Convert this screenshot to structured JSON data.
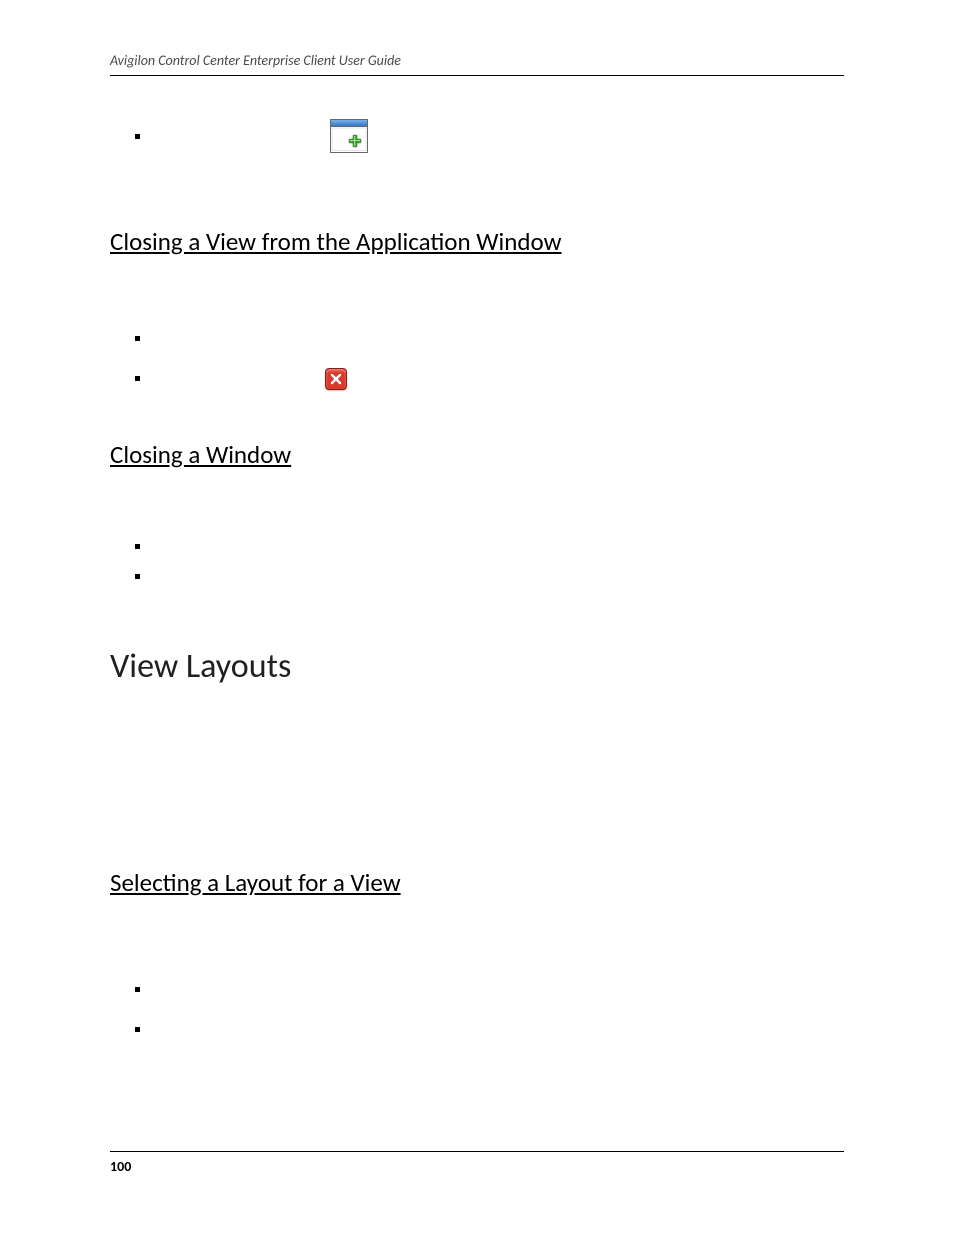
{
  "header": {
    "running_title": "Avigilon Control Center Enterprise Client User Guide"
  },
  "icons": {
    "add_view": "add-view-icon",
    "close_tab": "close-tab-icon"
  },
  "sections": {
    "closing_view": {
      "title": "Closing a View from the Application Window"
    },
    "closing_window": {
      "title": "Closing a Window"
    },
    "view_layouts": {
      "title": "View Layouts"
    },
    "selecting_layout": {
      "title": "Selecting a Layout for a View"
    }
  },
  "footer": {
    "page_number": "100"
  }
}
